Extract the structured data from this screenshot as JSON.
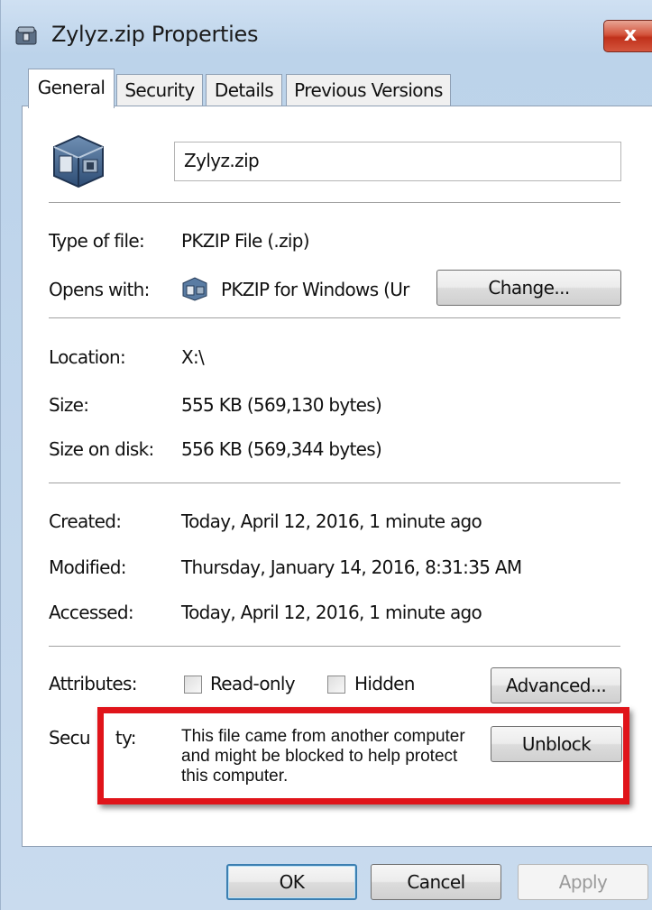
{
  "window": {
    "title": "Zylyz.zip Properties",
    "close_symbol": "x",
    "icon": "zip-archive-icon"
  },
  "tabs": [
    {
      "label": "General",
      "active": true
    },
    {
      "label": "Security",
      "active": false
    },
    {
      "label": "Details",
      "active": false
    },
    {
      "label": "Previous Versions",
      "active": false
    }
  ],
  "general": {
    "file_name": "Zylyz.zip",
    "type_label": "Type of file:",
    "type_value": "PKZIP File (.zip)",
    "opens_label": "Opens with:",
    "opens_value": "PKZIP for Windows (Ur",
    "change_button": "Change...",
    "location_label": "Location:",
    "location_value": "X:\\",
    "size_label": "Size:",
    "size_value": "555 KB (569,130 bytes)",
    "size_on_disk_label": "Size on disk:",
    "size_on_disk_value": "556 KB (569,344 bytes)",
    "created_label": "Created:",
    "created_value": "Today, April 12, 2016, 1 minute ago",
    "modified_label": "Modified:",
    "modified_value": "Thursday, January 14, 2016, 8:31:35 AM",
    "accessed_label": "Accessed:",
    "accessed_value": "Today, April 12, 2016, 1 minute ago",
    "attributes_label": "Attributes:",
    "readonly_label": "Read-only",
    "hidden_label": "Hidden",
    "readonly_checked": false,
    "hidden_checked": false,
    "advanced_button": "Advanced...",
    "security_label_start": "Secu",
    "security_label_end": "ty:",
    "security_message": "This file came from another computer and might be blocked to help protect this computer.",
    "unblock_button": "Unblock"
  },
  "footer": {
    "ok": "OK",
    "cancel": "Cancel",
    "apply": "Apply"
  },
  "colors": {
    "highlight": "#e0141a",
    "default_button_border": "#3c7fb1"
  }
}
